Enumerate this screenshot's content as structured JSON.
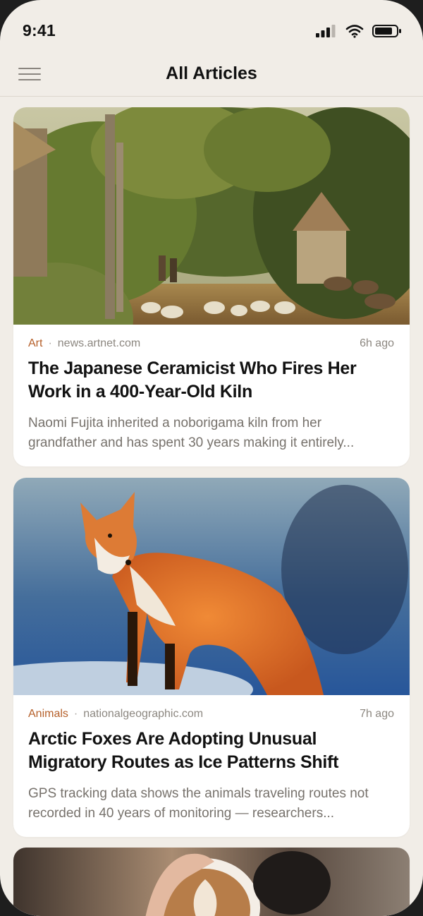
{
  "status_bar": {
    "time": "9:41"
  },
  "nav": {
    "title": "All Articles"
  },
  "articles": [
    {
      "category": "Art",
      "source": "news.artnet.com",
      "age": "6h ago",
      "title": "The Japanese Ceramicist Who Fires Her Work in a 400-Year-Old Kiln",
      "excerpt": "Naomi Fujita inherited a noborigama kiln from her grandfather and has spent 30 years making it entirely..."
    },
    {
      "category": "Animals",
      "source": "nationalgeographic.com",
      "age": "7h ago",
      "title": "Arctic Foxes Are Adopting Unusual Migratory Routes as Ice Patterns Shift",
      "excerpt": "GPS tracking data shows the animals traveling routes not recorded in 40 years of monitoring — researchers..."
    }
  ],
  "colors": {
    "background": "#f1ede7",
    "card": "#ffffff",
    "category_accent": "#b55f29",
    "meta_text": "#8c8780",
    "title_text": "#121212",
    "excerpt_text": "#77726c"
  },
  "icons": {
    "menu": "hamburger-menu-icon",
    "signal": "cellular-signal-icon",
    "wifi": "wifi-icon",
    "battery": "battery-icon"
  }
}
